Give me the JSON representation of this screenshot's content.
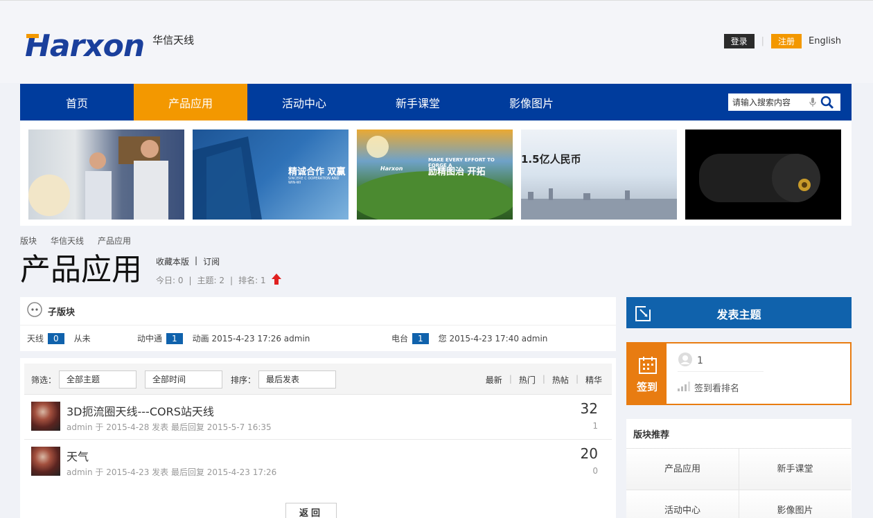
{
  "header": {
    "logo_text": "Harxon",
    "logo_subtitle": "华信天线",
    "login_label": "登录",
    "separator": "|",
    "register_label": "注册",
    "language_label": "English"
  },
  "nav": {
    "items": [
      {
        "label": "首页"
      },
      {
        "label": "产品应用"
      },
      {
        "label": "活动中心"
      },
      {
        "label": "新手课堂"
      },
      {
        "label": "影像图片"
      }
    ],
    "search_placeholder": "请输入搜索内容"
  },
  "banner": {
    "slides": [
      {
        "caption": ""
      },
      {
        "caption": "精诚合作  双赢"
      },
      {
        "caption": "励精图治  开拓"
      },
      {
        "caption": "1.5亿人民币"
      },
      {
        "caption": ""
      }
    ],
    "slide2_small": "SINCERE C OOPERATION AND WIN-WI",
    "slide3_logo": "Harxon",
    "slide3_en": "MAKE EVERY EFFORT TO FORGE A"
  },
  "breadcrumb": [
    "版块",
    "华信天线",
    "产品应用"
  ],
  "forum": {
    "title": "产品应用",
    "favorite_label": "收藏本版",
    "subscribe_label": "订阅",
    "pipe": "|",
    "today": "今日: 0",
    "topics": "主题: 2",
    "rank": "排名: 1"
  },
  "subforum": {
    "heading": "子版块",
    "items": [
      {
        "name": "天线",
        "count": "0",
        "last": "从未"
      },
      {
        "name": "动中通",
        "count": "1",
        "last": "动画 2015-4-23 17:26 admin"
      },
      {
        "name": "电台",
        "count": "1",
        "last": "您 2015-4-23 17:40 admin"
      }
    ]
  },
  "filters": {
    "filter_label": "筛选：",
    "topic_select": "全部主题",
    "time_select": "全部时间",
    "sort_label": "排序：",
    "sort_select": "最后发表",
    "sort_links": [
      "最新",
      "热门",
      "热帖",
      "精华"
    ]
  },
  "threads": [
    {
      "title": "3D扼流圈天线---CORS站天线",
      "meta": "admin  于 2015-4-28 发表   最后回复 2015-5-7 16:35",
      "replies": "32",
      "views": "1"
    },
    {
      "title": "天气",
      "meta": "admin  于 2015-4-23 发表   最后回复 2015-4-23 17:26",
      "replies": "20",
      "views": "0"
    }
  ],
  "back_label": "返回",
  "sidebar": {
    "post_label": "发表主题",
    "signin_label": "签到",
    "signin_count": "1",
    "signin_rank_label": "签到看排名",
    "recommend_title": "版块推荐",
    "recommend_items": [
      "产品应用",
      "新手课堂",
      "活动中心",
      "影像图片"
    ]
  },
  "colors": {
    "brand_blue": "#003c9d",
    "accent_orange": "#f39800",
    "badge_blue": "#1062ac",
    "signin_orange": "#e87c11"
  }
}
